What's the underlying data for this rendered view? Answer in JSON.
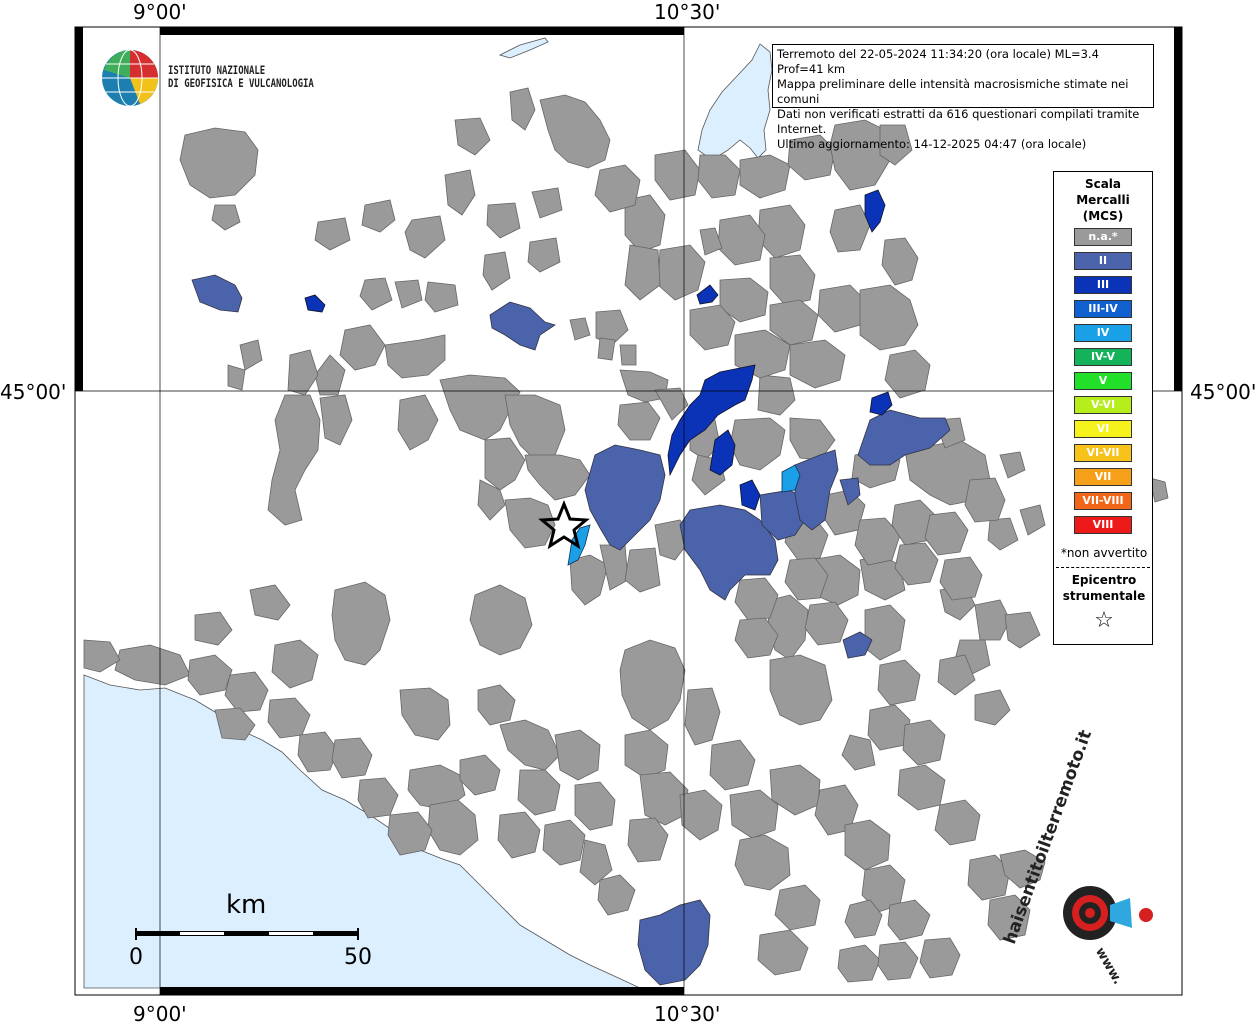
{
  "coords": {
    "top_left": "9°00'",
    "top_right": "10°30'",
    "bottom_left": "9°00'",
    "bottom_right": "10°30'",
    "left_lat": "45°00'",
    "right_lat": "45°00'"
  },
  "logo": {
    "line1": "ISTITUTO NAZIONALE",
    "line2": "DI GEOFISICA E VULCANOLOGIA"
  },
  "info": {
    "line1": "Terremoto del 22-05-2024 11:34:20 (ora locale) ML=3.4 Prof=41 km",
    "line2": "Mappa preliminare delle intensità macrosismiche stimate nei comuni",
    "line3": "Dati non verificati estratti da 616 questionari compilati tramite Internet.",
    "line4": "Ultimo aggiornamento: 14-12-2025 04:47 (ora locale)"
  },
  "legend": {
    "title1": "Scala",
    "title2": "Mercalli",
    "title3": "(MCS)",
    "items": [
      {
        "label": "n.a.*",
        "color": "#9a9a9a"
      },
      {
        "label": "II",
        "color": "#4a63ab"
      },
      {
        "label": "III",
        "color": "#0b33b8"
      },
      {
        "label": "III-IV",
        "color": "#1060d0"
      },
      {
        "label": "IV",
        "color": "#1aa0e6"
      },
      {
        "label": "IV-V",
        "color": "#14b35a"
      },
      {
        "label": "V",
        "color": "#22e02a"
      },
      {
        "label": "V-VI",
        "color": "#b6ee1c"
      },
      {
        "label": "VI",
        "color": "#f6f21c"
      },
      {
        "label": "VI-VII",
        "color": "#f7c21a"
      },
      {
        "label": "VII",
        "color": "#f6a01a"
      },
      {
        "label": "VII-VIII",
        "color": "#f2661a"
      },
      {
        "label": "VIII",
        "color": "#ee1a1a"
      }
    ],
    "note": "*non avvertito",
    "epi1": "Epicentro",
    "epi2": "strumentale",
    "epi_symbol": "☆"
  },
  "scalebar": {
    "unit": "km",
    "min": "0",
    "max": "50"
  },
  "watermark": {
    "text": "haisentitoilterremoto.it",
    "url": "www."
  },
  "colors": {
    "sea": "#dcefff",
    "land": "#ffffff",
    "na": "#9a9a9a",
    "ii": "#4a63ab",
    "iii": "#0b33b8",
    "iv": "#1aa0e6"
  }
}
